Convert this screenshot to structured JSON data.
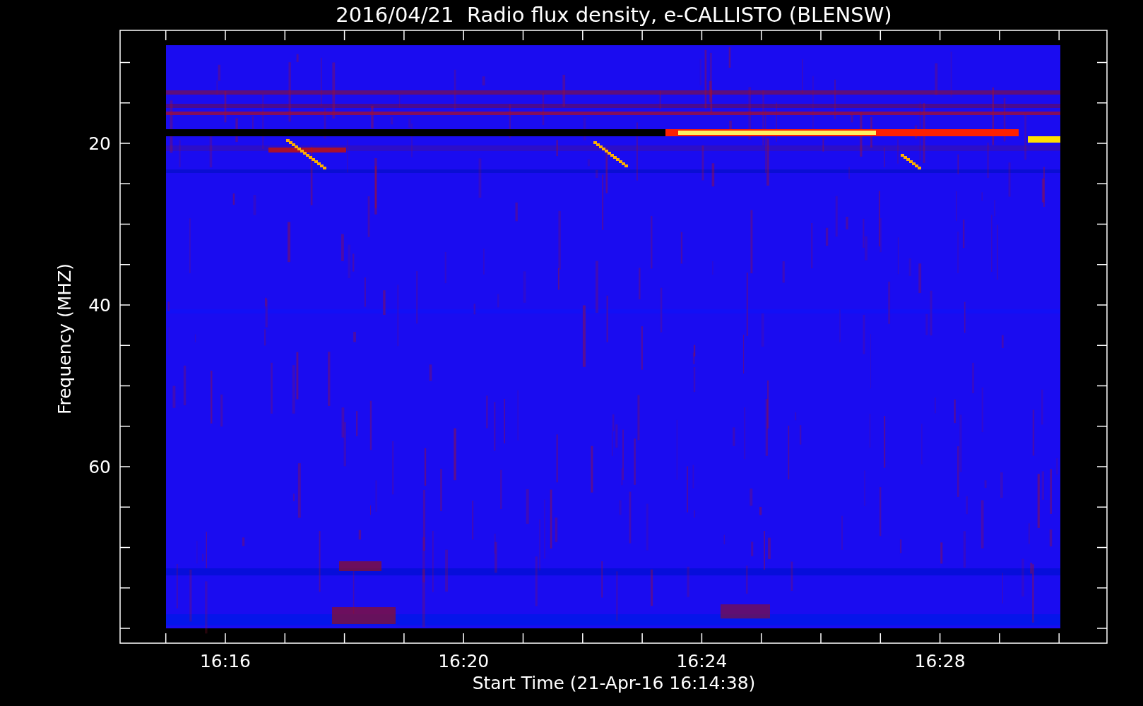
{
  "title": "2016/04/21  Radio flux density, e-CALLISTO (BLENSW)",
  "plot": {
    "ylabel": "Frequency (MHZ)",
    "xlabel": "Start Time (21-Apr-16 16:14:38)",
    "yticks": [
      {
        "label": "20"
      },
      {
        "label": "40"
      },
      {
        "label": "60"
      }
    ],
    "xticks": [
      {
        "label": "16:16"
      },
      {
        "label": "16:20"
      },
      {
        "label": "16:24"
      },
      {
        "label": "16:28"
      }
    ]
  }
}
